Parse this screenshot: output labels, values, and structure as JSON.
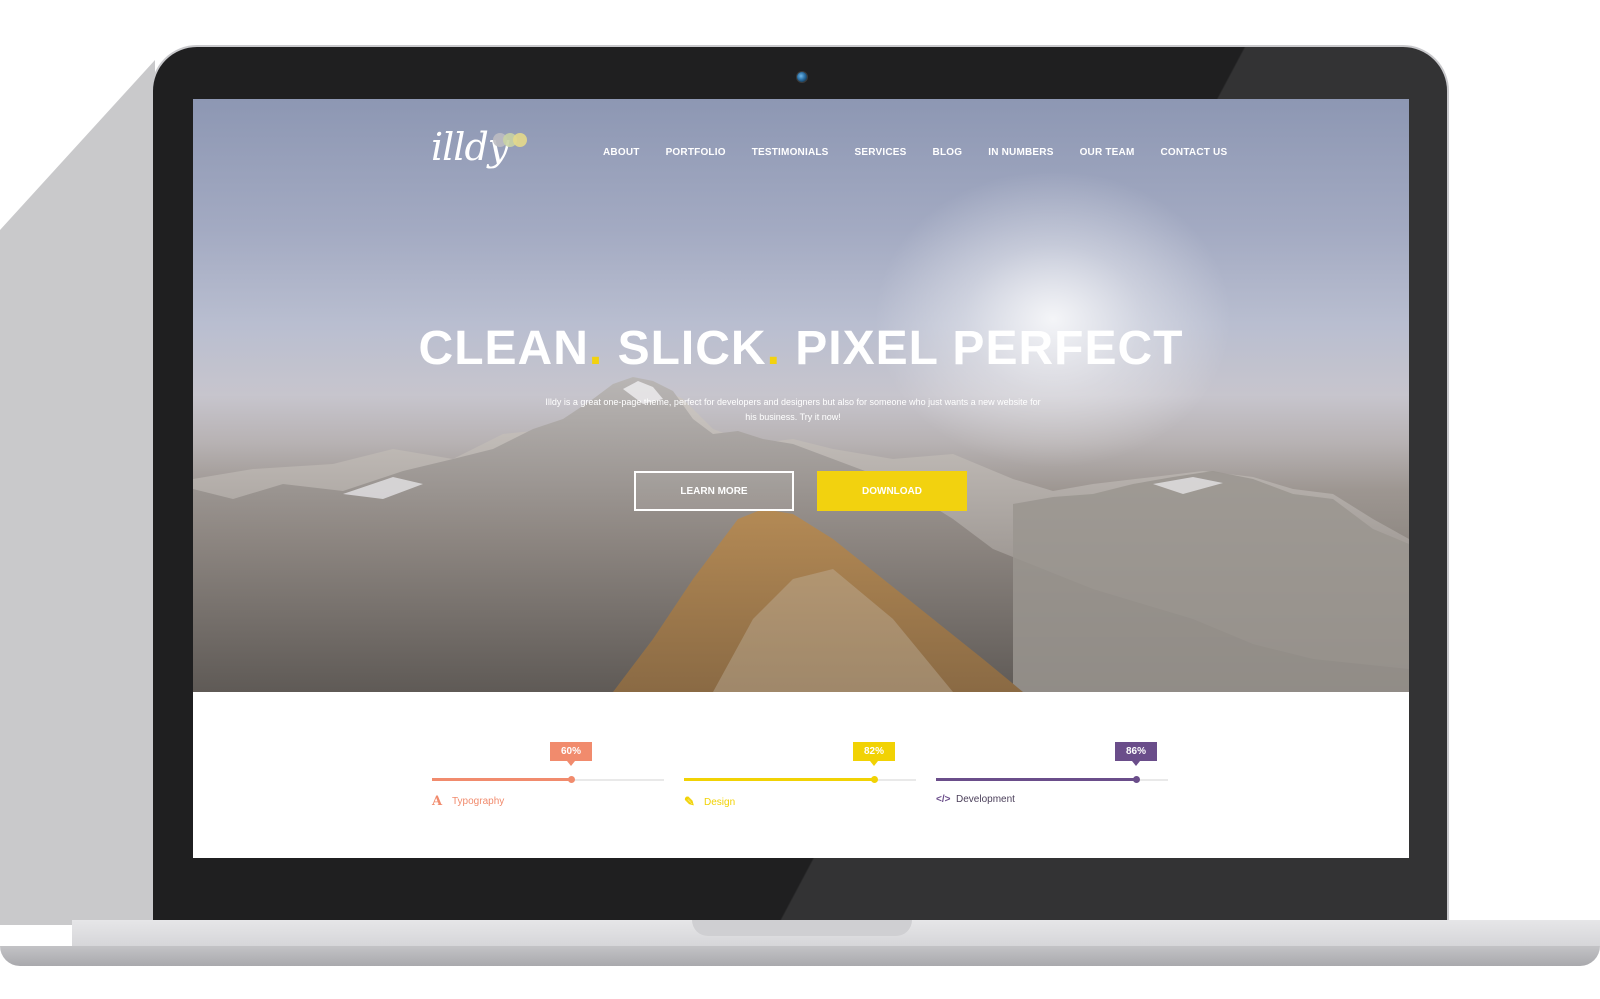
{
  "site": {
    "logo": {
      "text": "illdy",
      "dot_colors": [
        "#bdbdc2",
        "#c9d3a4",
        "#e4d98b"
      ]
    },
    "nav": [
      {
        "label": "ABOUT"
      },
      {
        "label": "PORTFOLIO"
      },
      {
        "label": "TESTIMONIALS"
      },
      {
        "label": "SERVICES"
      },
      {
        "label": "BLOG"
      },
      {
        "label": "IN NUMBERS"
      },
      {
        "label": "OUR TEAM"
      },
      {
        "label": "CONTACT US"
      }
    ],
    "hero": {
      "headline_part1": "CLEAN",
      "headline_part2": "SLICK",
      "headline_part3": "PIXEL PERFECT",
      "headline_dot": ".",
      "subtext": "Illdy is a great one-page theme, perfect for developers and designers but also for someone who just wants a new website for his business. Try it now!",
      "learn_more_label": "LEARN MORE",
      "download_label": "DOWNLOAD"
    },
    "skills": [
      {
        "label": "Typography",
        "percent_label": "60%",
        "value": 0.6,
        "color": "#f18b6d",
        "icon": "typography-icon",
        "glyph": "A"
      },
      {
        "label": "Design",
        "percent_label": "82%",
        "value": 0.82,
        "color": "#f1d204",
        "icon": "pencil-icon",
        "glyph": "✎"
      },
      {
        "label": "Development",
        "percent_label": "86%",
        "value": 0.86,
        "color": "#6a4d8a",
        "icon": "code-icon",
        "glyph": "</>"
      }
    ]
  },
  "colors": {
    "accent_yellow": "#f2d20f",
    "frame_black": "#1f1f20",
    "base_silver": "#d6d6d9"
  }
}
